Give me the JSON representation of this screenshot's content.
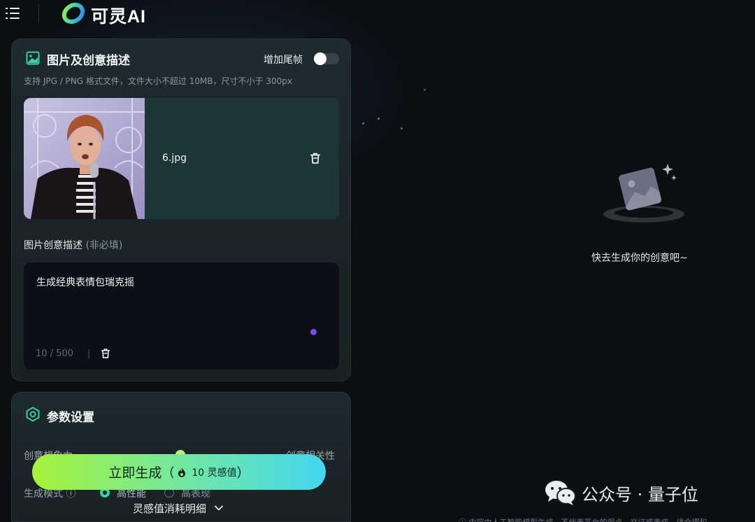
{
  "header": {
    "logo_text": "可灵AI"
  },
  "upload_panel": {
    "title": "图片及创意描述",
    "end_frame_label": "增加尾帧",
    "end_frame_enabled": false,
    "hint": "支持 JPG / PNG 格式文件，文件大小不超过 10MB，尺寸不小于 300px",
    "file_name": "6.jpg",
    "prompt_label": "图片创意描述",
    "prompt_optional": "(非必填)",
    "prompt_text": "生成经典表情包瑞克摇",
    "char_count": "10 / 500",
    "count_separator": "|"
  },
  "params_panel": {
    "title": "参数设置",
    "slider_left": "创意想象力",
    "slider_right": "创意相关性",
    "mode_label": "生成模式 ⓘ",
    "mode_options": [
      "高性能",
      "高表现"
    ],
    "mode_selected": "高性能"
  },
  "generate": {
    "label": "立即生成",
    "cost": "10 灵感值",
    "paren_open": "（",
    "paren_close": "）"
  },
  "cost_detail": "灵感值消耗明细",
  "empty_state": {
    "text": "快去生成你的创意吧~"
  },
  "watermark": {
    "text": "公众号 · 量子位"
  },
  "footer_note": "ⓘ 内容由人工智能模型生成，不代表平台的观点，文证或表症，请合理和"
}
